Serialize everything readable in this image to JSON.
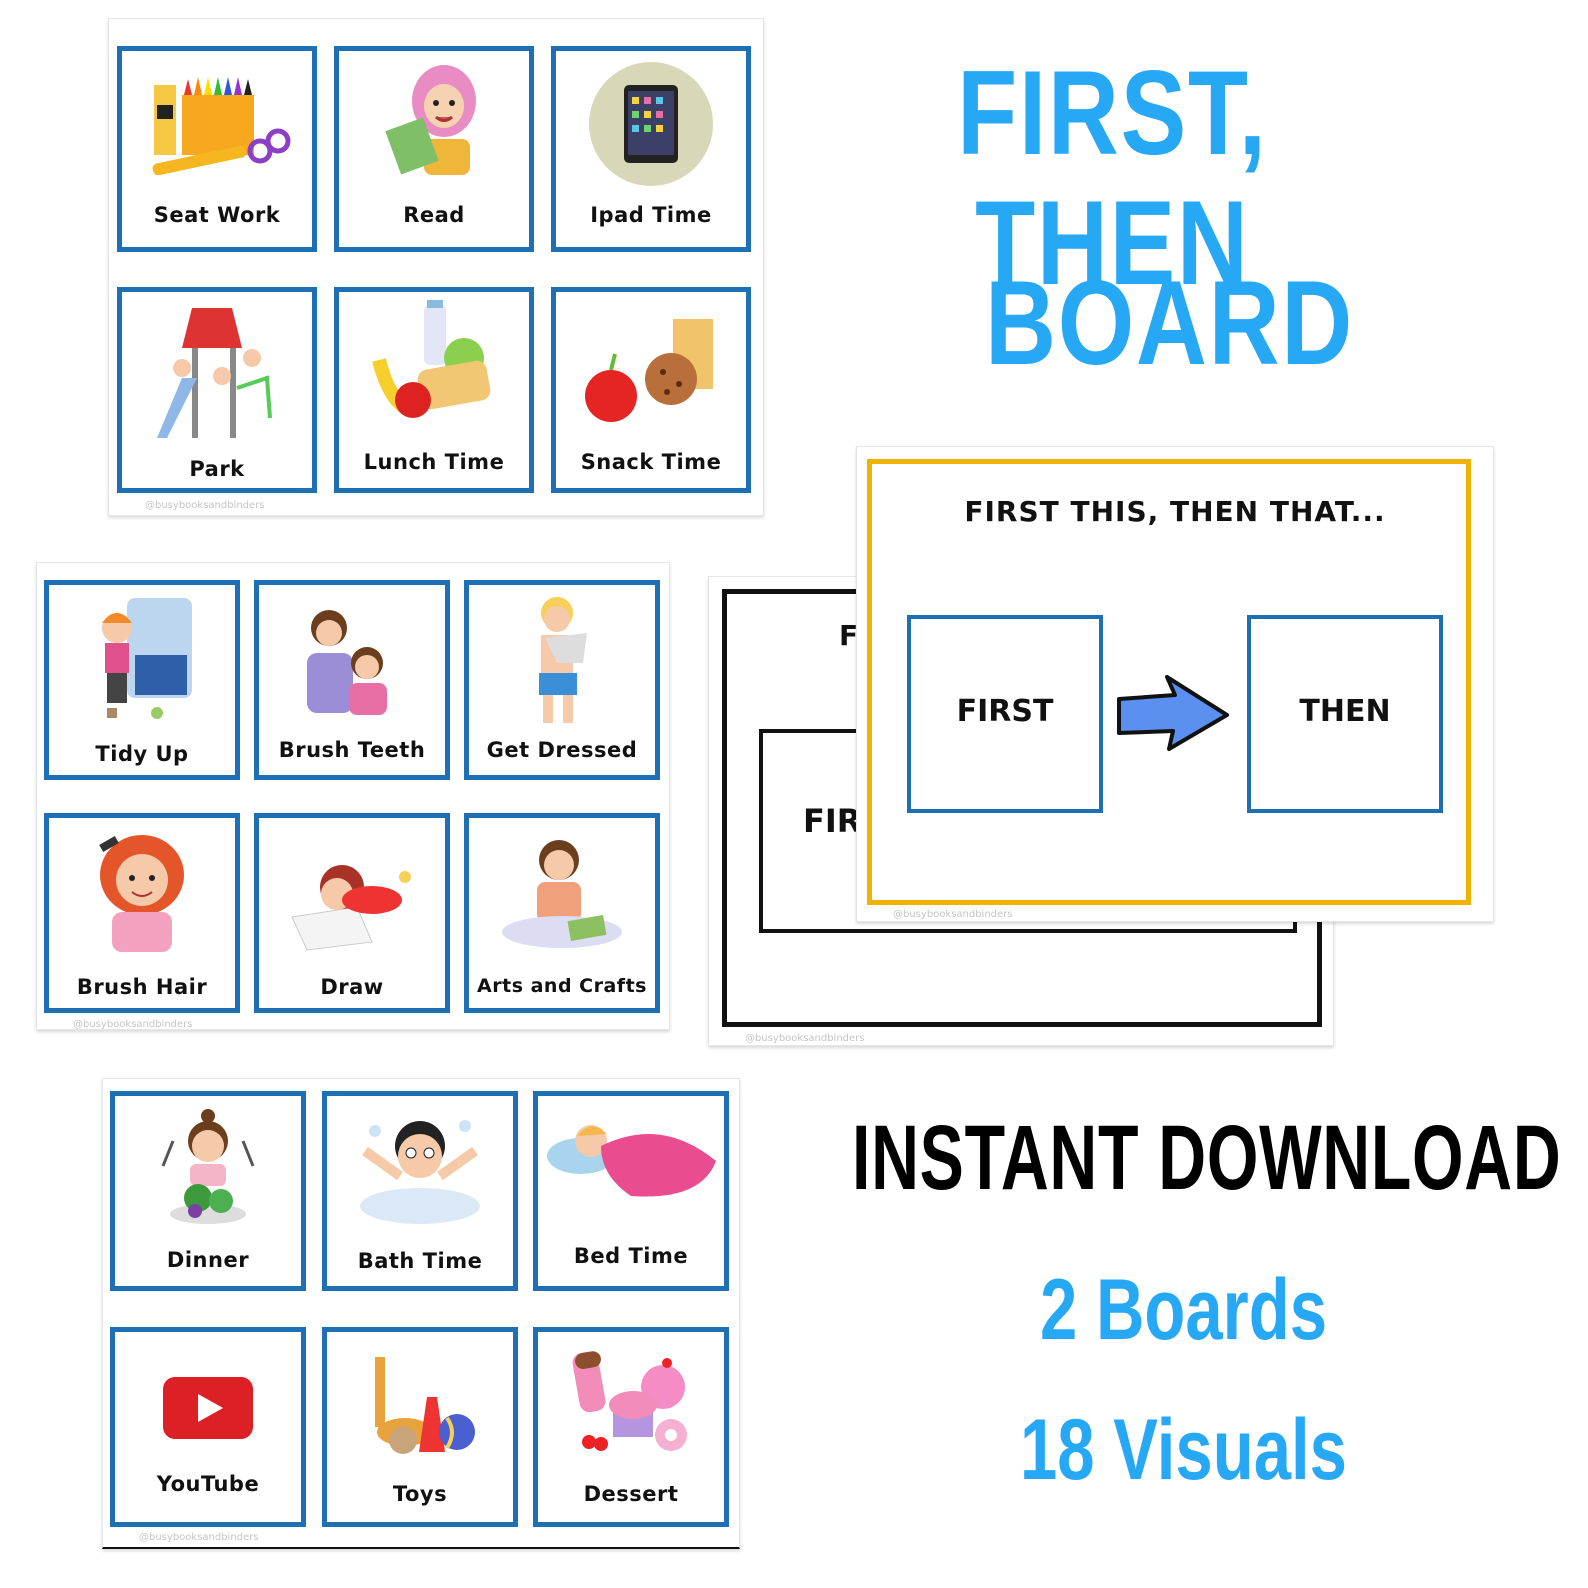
{
  "headline": {
    "line1": "FIRST, THEN",
    "line2": "BOARD"
  },
  "promo": {
    "instant": "INSTANT DOWNLOAD",
    "boards": "2 Boards",
    "visuals": "18 Visuals"
  },
  "watermark": "@busybooksandbinders",
  "sheet1": {
    "cards": [
      {
        "label": "Seat Work",
        "icon": "school-supplies-icon"
      },
      {
        "label": "Read",
        "icon": "reading-girl-icon"
      },
      {
        "label": "Ipad Time",
        "icon": "tablet-icon"
      },
      {
        "label": "Park",
        "icon": "playground-icon"
      },
      {
        "label": "Lunch Time",
        "icon": "lunch-food-icon"
      },
      {
        "label": "Snack Time",
        "icon": "snack-apple-cookie-icon"
      }
    ]
  },
  "sheet2": {
    "cards": [
      {
        "label": "Tidy Up",
        "icon": "tidy-up-icon"
      },
      {
        "label": "Brush Teeth",
        "icon": "brush-teeth-icon"
      },
      {
        "label": "Get Dressed",
        "icon": "get-dressed-icon"
      },
      {
        "label": "Brush Hair",
        "icon": "brush-hair-icon"
      },
      {
        "label": "Draw",
        "icon": "draw-icon"
      },
      {
        "label": "Arts and Crafts",
        "icon": "arts-crafts-icon"
      }
    ]
  },
  "sheet3": {
    "cards": [
      {
        "label": "Dinner",
        "icon": "dinner-icon"
      },
      {
        "label": "Bath Time",
        "icon": "bath-icon"
      },
      {
        "label": "Bed Time",
        "icon": "bed-icon"
      },
      {
        "label": "YouTube",
        "icon": "youtube-icon"
      },
      {
        "label": "Toys",
        "icon": "toys-icon"
      },
      {
        "label": "Dessert",
        "icon": "dessert-icon"
      }
    ]
  },
  "board_front": {
    "heading": "FIRST THIS, THEN THAT...",
    "first": "FIRST",
    "then": "THEN",
    "arrow": "right-arrow-icon"
  },
  "board_back": {
    "heading_partial": "F",
    "first_partial": "FIRS"
  },
  "colors": {
    "title_blue": "#27a8f5",
    "card_border": "#1f6fb5",
    "board_gold": "#f0b400",
    "arrow_fill": "#5b8ff0"
  }
}
